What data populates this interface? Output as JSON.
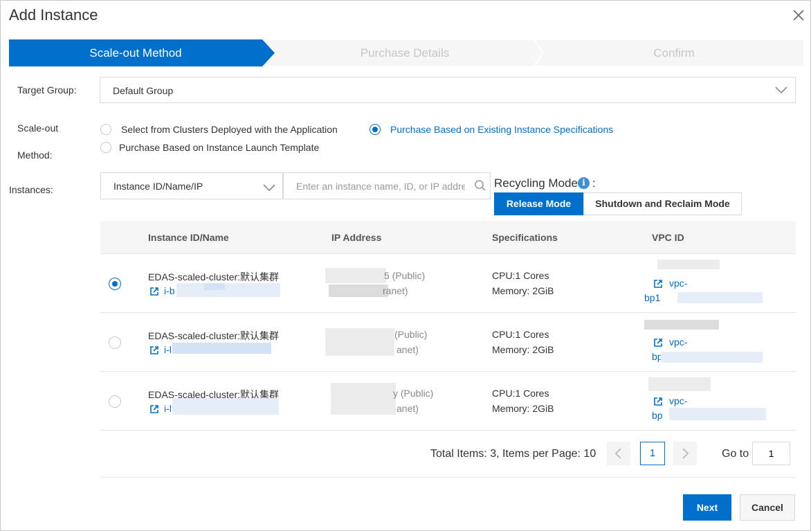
{
  "dialog": {
    "title": "Add Instance"
  },
  "steps": [
    {
      "label": "Scale-out Method",
      "active": true
    },
    {
      "label": "Purchase Details",
      "active": false
    },
    {
      "label": "Confirm",
      "active": false
    }
  ],
  "form": {
    "target_group_label": "Target Group:",
    "target_group_value": "Default Group",
    "method_label_line1": "Scale-out",
    "method_label_line2": "Method:",
    "method_options": [
      {
        "label": "Select from Clusters Deployed with the Application",
        "selected": false
      },
      {
        "label": "Purchase Based on Existing Instance Specifications",
        "selected": true
      },
      {
        "label": "Purchase Based on Instance Launch Template",
        "selected": false
      }
    ],
    "instances_label": "Instances:",
    "search_type_value": "Instance ID/Name/IP",
    "search_placeholder": "Enter an instance name, ID, or IP address",
    "recycling_mode_label": "Recycling Mode",
    "recycling_colon": ":",
    "recycling_modes": [
      {
        "label": "Release Mode",
        "selected": true
      },
      {
        "label": "Shutdown and Reclaim Mode",
        "selected": false
      }
    ]
  },
  "table": {
    "headers": [
      "Instance ID/Name",
      "IP Address",
      "Specifications",
      "VPC ID"
    ],
    "rows": [
      {
        "selected": true,
        "name": "EDAS-scaled-cluster:默认集群",
        "id_prefix": "i-b",
        "ip_public_tail": "5 (Public)",
        "ip_private_tail": "ranet)",
        "cpu": "CPU:1 Cores",
        "memory": "Memory: 2GiB",
        "vpc_prefix": "vpc-",
        "vpc_line2": "bp1"
      },
      {
        "selected": false,
        "name": "EDAS-scaled-cluster:默认集群",
        "id_prefix": "i-l",
        "ip_public_tail": "(Public)",
        "ip_private_tail": "anet)",
        "cpu": "CPU:1 Cores",
        "memory": "Memory: 2GiB",
        "vpc_prefix": "vpc-",
        "vpc_line2": "bp"
      },
      {
        "selected": false,
        "name": "EDAS-scaled-cluster:默认集群",
        "id_prefix": "i-l",
        "ip_public_tail": "y (Public)",
        "ip_private_tail": "anet)",
        "cpu": "CPU:1 Cores",
        "memory": "Memory: 2GiB",
        "vpc_prefix": "vpc-",
        "vpc_line2": "bp"
      }
    ]
  },
  "pagination": {
    "summary": "Total Items: 3, Items per Page: 10",
    "current_page": "1",
    "goto_label": "Go to",
    "goto_value": "1"
  },
  "footer": {
    "next_label": "Next",
    "cancel_label": "Cancel"
  },
  "colors": {
    "primary": "#0070cc",
    "step_inactive_bg": "#f6f6f6",
    "step_inactive_text": "#c7c7c7"
  }
}
